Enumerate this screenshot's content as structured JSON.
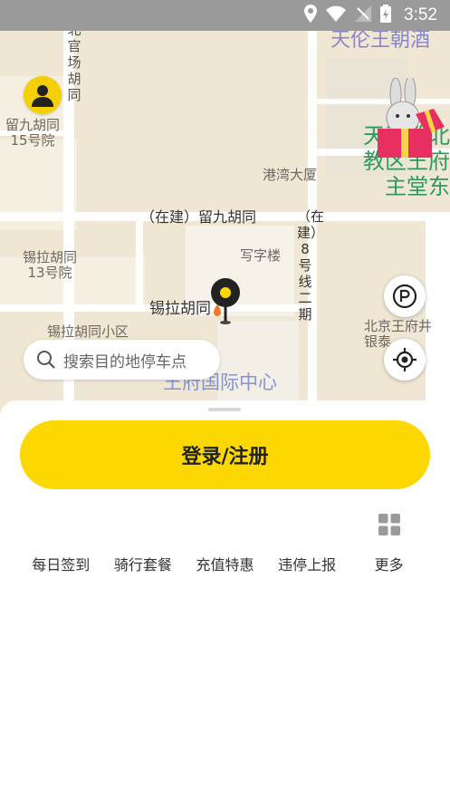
{
  "status_bar": {
    "time": "3:52"
  },
  "map": {
    "street_labels": {
      "beiguanchang": "北官场胡同",
      "liujiu_15": "留九胡同\n15号院",
      "liujiu": "（在建）留九胡同",
      "xila_13": "锡拉胡同\n13号院",
      "xila": "锡拉胡同",
      "xila_xiaoqu": "锡拉胡同小区",
      "gangwan": "港湾大厦",
      "xiezilou": "写字楼",
      "line8": "（在建）8号线二期",
      "wangfujing": "北京王府井\n银泰"
    },
    "poi": {
      "church": "天王教北\n教区王府\n主堂东",
      "hotel": "天伦王朝酒",
      "intl_center": "王府国际中心"
    }
  },
  "search": {
    "placeholder": "搜索目的地停车点"
  },
  "sheet": {
    "login_label": "登录/注册",
    "quick_actions": [
      {
        "label": "每日签到"
      },
      {
        "label": "骑行套餐"
      },
      {
        "label": "充值特惠"
      },
      {
        "label": "违停上报"
      },
      {
        "label": "更多",
        "icon": "grid-icon"
      }
    ]
  },
  "colors": {
    "accent": "#fdd800",
    "map_bg": "#efe6d3",
    "road": "#ffffff"
  }
}
